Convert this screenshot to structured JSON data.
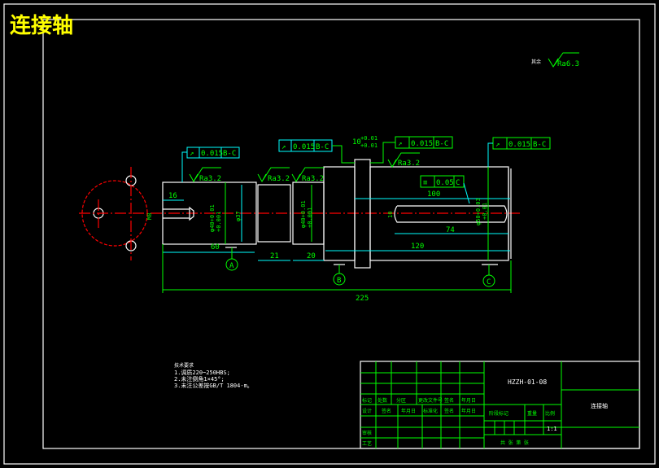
{
  "title": "连接轴",
  "roughness_other": {
    "label": "其余",
    "value": "Ra6.3"
  },
  "tolerance_frames": [
    {
      "symbol": "↗",
      "value": "0.015",
      "datum": "B-C"
    },
    {
      "symbol": "↗",
      "value": "0.015",
      "datum": "B-C"
    },
    {
      "symbol": "↗",
      "value": "0.015",
      "datum": "B-C"
    },
    {
      "symbol": "↗",
      "value": "0.015",
      "datum": "B-C"
    },
    {
      "symbol": "≡",
      "value": "0.05",
      "datum": "C"
    }
  ],
  "roughness": [
    "Ra3.2",
    "Ra3.2",
    "Ra3.2",
    "Ra3.2"
  ],
  "dimensions": {
    "d16": "16",
    "d60": "60",
    "d21": "21",
    "d20": "20",
    "d225": "225",
    "d100": "100",
    "d120": "120",
    "d74": "74",
    "d10": "10",
    "tol_up": "+0.01",
    "tol_lo": "+0.01",
    "phi40a": "φ40+0.01",
    "phi40a2": "+0.001",
    "phi37": "φ37",
    "phi40b": "φ40+0.01",
    "phi40b2": "+0.001",
    "m8": "M8",
    "phi50": "φ50+0.03",
    "phi50b": "+0.01",
    "key": "10"
  },
  "datums": [
    "A",
    "B",
    "C"
  ],
  "notes": {
    "heading": "技术要求",
    "lines": [
      "1.调质220~250HBS;",
      "2.未注倒角1×45°;",
      "3.未注公差按GB/T 1804-m。"
    ]
  },
  "title_block": {
    "drawing_no": "HZZH-01-08",
    "part_name": "连接轴",
    "row1": [
      "标记",
      "处数",
      "分区",
      "更改文件号",
      "签名",
      "年月日"
    ],
    "row2": [
      "设计",
      "签名",
      "年月日",
      "标准化",
      "签名",
      "年月日"
    ],
    "left": [
      "审核",
      "工艺"
    ],
    "stage": "阶段标记",
    "weight": "重量",
    "scale_label": "比例",
    "scale": "1:1",
    "sheets": "共  张  第  张"
  }
}
